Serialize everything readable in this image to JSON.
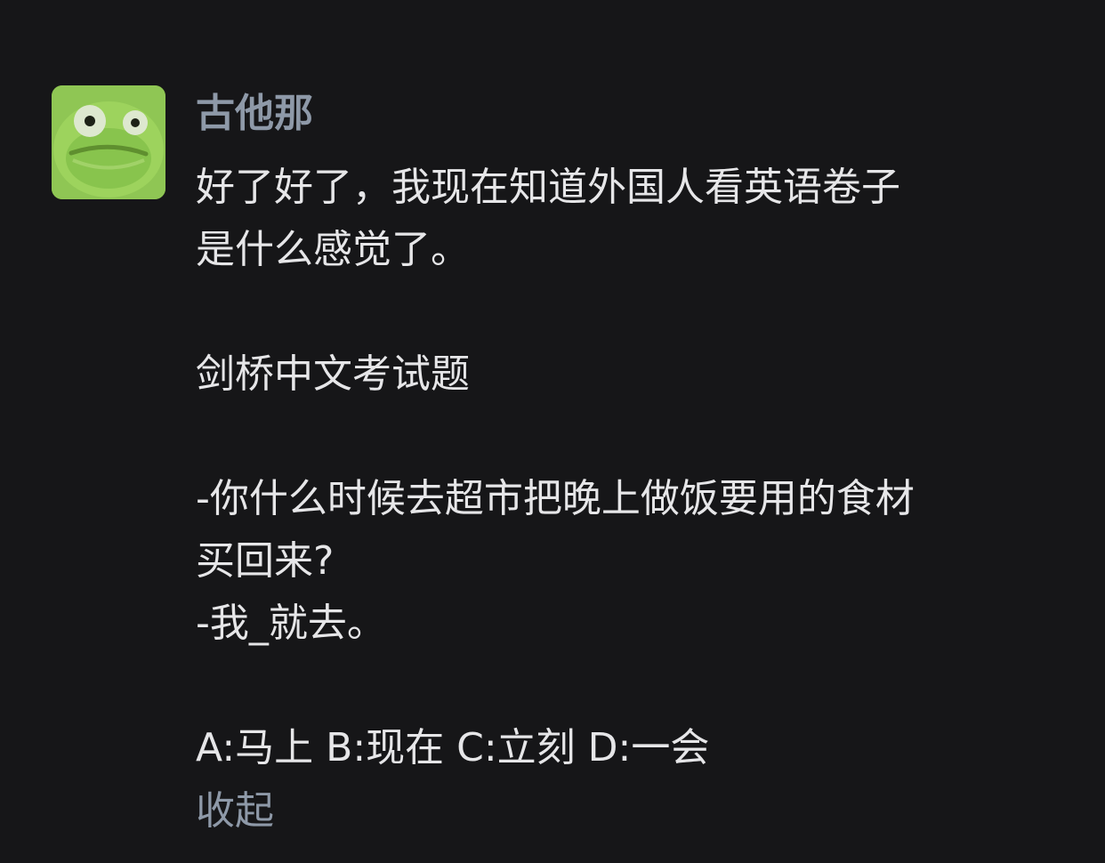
{
  "post": {
    "username": "古他那",
    "avatar_icon": "green-frog-avatar-icon",
    "paragraphs": [
      "好了好了，我现在知道外国人看英语卷子",
      "是什么感觉了。",
      "",
      "剑桥中文考试题",
      "",
      "-你什么时候去超市把晚上做饭要用的食材",
      "买回来?",
      "-我_就去。",
      "",
      "A:马上 B:现在 C:立刻 D:一会"
    ],
    "collapse_label": "收起"
  },
  "colors": {
    "background": "#161618",
    "text": "#e6e6e8",
    "muted_link": "#8e99a8",
    "avatar_green": "#7fb73b"
  }
}
